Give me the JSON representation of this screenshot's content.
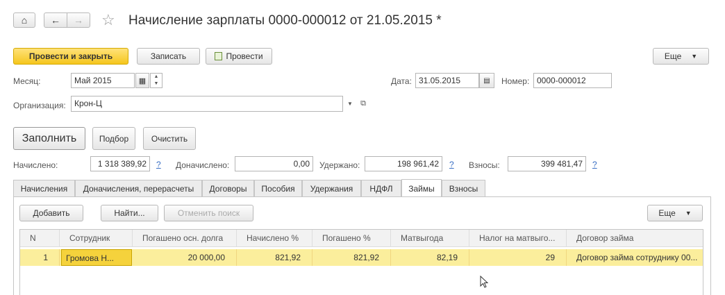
{
  "nav": {
    "home_glyph": "⌂",
    "back_glyph": "←",
    "forward_glyph": "→",
    "star_glyph": "☆"
  },
  "title": "Начисление зарплаты 0000-000012 от 21.05.2015 *",
  "toolbar": {
    "post_close": "Провести и закрыть",
    "save": "Записать",
    "post": "Провести",
    "more": "Еще"
  },
  "form": {
    "month_label": "Месяц:",
    "month_value": "Май 2015",
    "date_label": "Дата:",
    "date_value": "31.05.2015",
    "number_label": "Номер:",
    "number_value": "0000-000012",
    "org_label": "Организация:",
    "org_value": "Крон-Ц"
  },
  "actions": {
    "fill": "Заполнить",
    "select": "Подбор",
    "clear": "Очистить"
  },
  "totals": {
    "accrued_label": "Начислено:",
    "accrued_value": "1 318 389,92",
    "extra_label": "Доначислено:",
    "extra_value": "0,00",
    "withheld_label": "Удержано:",
    "withheld_value": "198 961,42",
    "contrib_label": "Взносы:",
    "contrib_value": "399 481,47",
    "help": "?"
  },
  "tabs": [
    {
      "label": "Начисления"
    },
    {
      "label": "Доначисления, перерасчеты"
    },
    {
      "label": "Договоры"
    },
    {
      "label": "Пособия"
    },
    {
      "label": "Удержания"
    },
    {
      "label": "НДФЛ"
    },
    {
      "label": "Займы"
    },
    {
      "label": "Взносы"
    }
  ],
  "active_tab": "Займы",
  "tab_toolbar": {
    "add": "Добавить",
    "find": "Найти...",
    "cancel_search": "Отменить поиск",
    "more": "Еще"
  },
  "table": {
    "headers": [
      "N",
      "Сотрудник",
      "Погашено осн. долга",
      "Начислено %",
      "Погашено %",
      "Матвыгода",
      "Налог на матвыго...",
      "Договор займа"
    ],
    "rows": [
      [
        "1",
        "Громова Н...",
        "20 000,00",
        "821,92",
        "821,92",
        "82,19",
        "29",
        "Договор займа сотруднику 00..."
      ]
    ]
  },
  "colors": {
    "accent": "#f5c61e",
    "row_highlight": "#fbee9c",
    "cell_selected": "#f5d23c",
    "link": "#3a6fc4"
  }
}
